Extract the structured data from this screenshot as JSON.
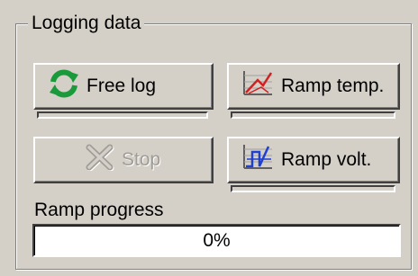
{
  "group": {
    "title": "Logging data"
  },
  "buttons": {
    "free_log": {
      "label": "Free log",
      "icon": "refresh-icon"
    },
    "ramp_temp": {
      "label": "Ramp temp.",
      "icon": "temperature-ramp-chart-icon"
    },
    "stop": {
      "label": "Stop",
      "icon": "stop-x-icon",
      "enabled": false
    },
    "ramp_volt": {
      "label": "Ramp volt.",
      "icon": "voltage-ramp-chart-icon"
    }
  },
  "ramp": {
    "label": "Ramp progress",
    "progress_percent": 0,
    "progress_text": "0%"
  },
  "colors": {
    "window_bg": "#d4d0c8",
    "refresh_green": "#1a9a3a",
    "chart_red": "#d22020",
    "chart_blue": "#1f3fd0",
    "progress_fill": "#0a246a"
  }
}
